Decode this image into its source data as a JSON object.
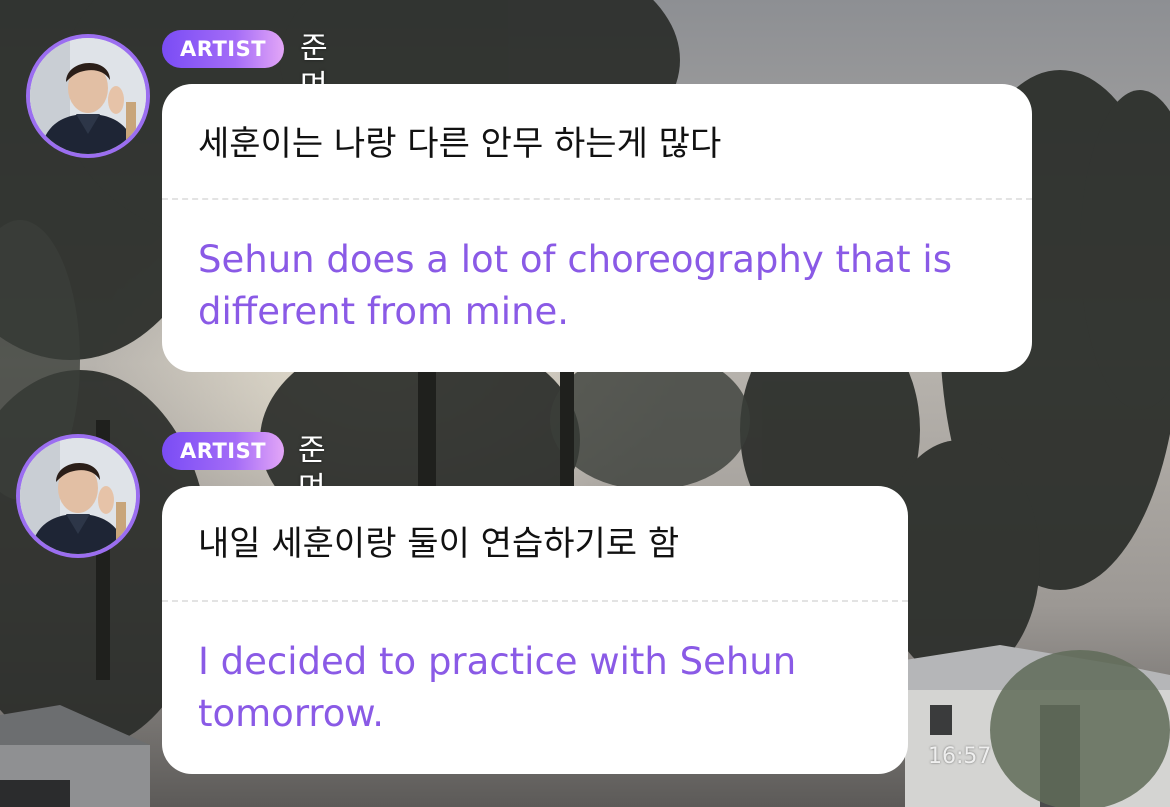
{
  "messages": [
    {
      "badge": "ARTIST",
      "sender": "준며니",
      "original": "세훈이는 나랑 다른 안무 하는게 많다",
      "translation": "Sehun does a lot of choreography that is different from mine."
    },
    {
      "badge": "ARTIST",
      "sender": "준며니",
      "original": "내일 세훈이랑 둘이 연습하기로 함",
      "translation": "I decided to practice with Sehun tomorrow.",
      "timestamp": "16:57"
    }
  ],
  "colors": {
    "badge_start": "#7a4cf5",
    "badge_end": "#e3a6f7",
    "avatar_ring": "#9b6ef0",
    "translation_text": "#8a5ae6",
    "bubble_bg": "#ffffff"
  },
  "icons": {
    "avatar": "artist-profile-photo"
  }
}
